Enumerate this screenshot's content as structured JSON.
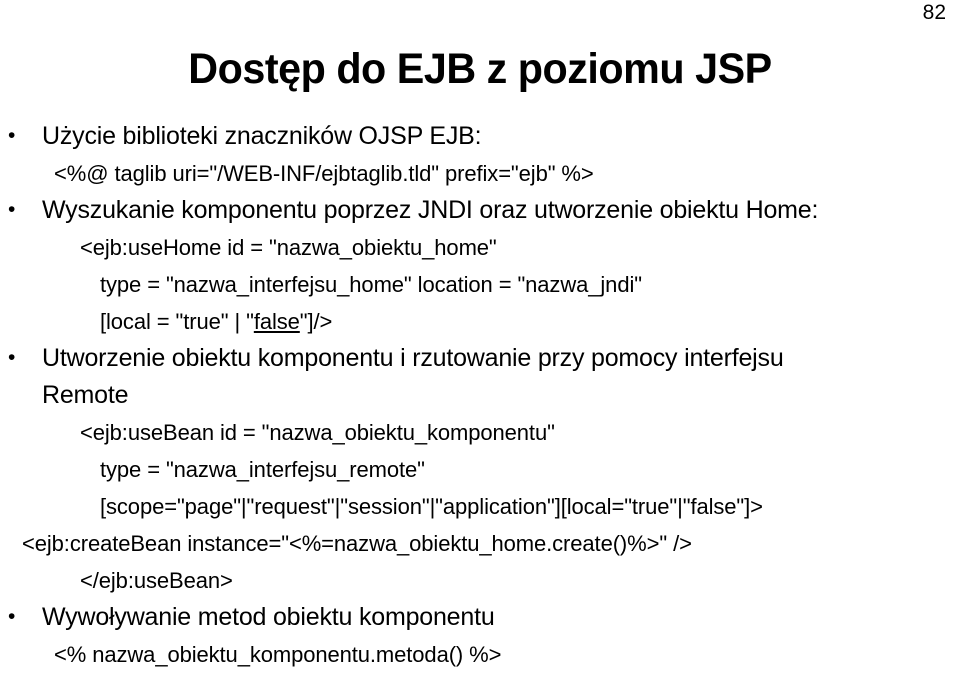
{
  "slide": {
    "number": "82",
    "title": "Dostęp do EJB z poziomu JSP",
    "background_color": "#ffffff",
    "text_color": "#000000",
    "bullet_glyph": "•"
  },
  "lines": [
    {
      "id": "l1",
      "level": "lvl1",
      "bulleted": true,
      "text": "Użycie biblioteki znaczników OJSP EJB:"
    },
    {
      "id": "l2",
      "level": "lvl2",
      "bulleted": false,
      "text": "<%@ taglib uri=\"/WEB-INF/ejbtaglib.tld\" prefix=\"ejb\" %>"
    },
    {
      "id": "l3",
      "level": "lvl1",
      "bulleted": true,
      "text": "Wyszukanie komponentu poprzez JNDI oraz utworzenie obiektu Home:"
    },
    {
      "id": "l4",
      "level": "lvl3",
      "bulleted": false,
      "text": "<ejb:useHome id = \"nazwa_obiektu_home\""
    },
    {
      "id": "l5",
      "level": "lvl4",
      "bulleted": false,
      "text": "type = \"nazwa_interfejsu_home\" location = \"nazwa_jndi\""
    },
    {
      "id": "l6",
      "level": "lvl4",
      "bulleted": false,
      "segments": [
        {
          "text": "[local = \"true\" | \"",
          "underline": false
        },
        {
          "text": "false",
          "underline": true
        },
        {
          "text": "\"]/>",
          "underline": false
        }
      ],
      "text": "[local = \"true\" | \"false\"]/>"
    },
    {
      "id": "l7",
      "level": "lvl1",
      "bulleted": true,
      "text": "Utworzenie obiektu komponentu i rzutowanie przy pomocy interfejsu"
    },
    {
      "id": "l8",
      "level": "lvl1cont",
      "bulleted": false,
      "text": "Remote"
    },
    {
      "id": "l9",
      "level": "lvl3",
      "bulleted": false,
      "text": "<ejb:useBean id = \"nazwa_obiektu_komponentu\""
    },
    {
      "id": "l10",
      "level": "lvl4",
      "bulleted": false,
      "text": "type = \"nazwa_interfejsu_remote\""
    },
    {
      "id": "l11",
      "level": "lvl4",
      "bulleted": false,
      "text": "[scope=\"page\"|\"request\"|\"session\"|\"application\"][local=\"true\"|\"false\"]>"
    },
    {
      "id": "l12",
      "level": "lvl4",
      "bulleted": false,
      "indent_extra": 22,
      "text": "<ejb:createBean instance=\"<%=nazwa_obiektu_home.create()%>\" />"
    },
    {
      "id": "l13",
      "level": "lvl3",
      "bulleted": false,
      "text": "</ejb:useBean>"
    },
    {
      "id": "l14",
      "level": "lvl1",
      "bulleted": true,
      "text": "Wywoływanie metod obiektu komponentu"
    },
    {
      "id": "l15",
      "level": "lvl2",
      "bulleted": false,
      "text": "<% nazwa_obiektu_komponentu.metoda() %>"
    }
  ]
}
